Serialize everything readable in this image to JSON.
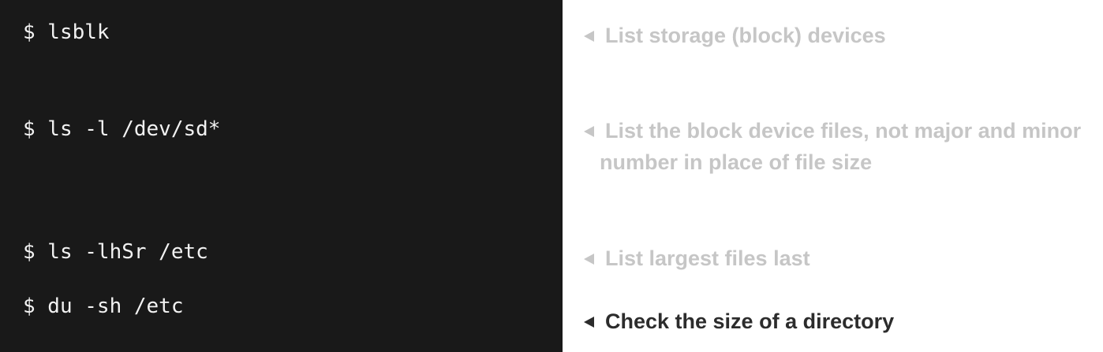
{
  "commands": [
    {
      "text": "$ lsblk"
    },
    {
      "text": "$ ls -l /dev/sd*"
    },
    {
      "text": "$ ls -lhSr /etc"
    },
    {
      "text": "$ du -sh /etc"
    }
  ],
  "notes": [
    {
      "line1": "List storage (block) devices",
      "line2": "",
      "active": false
    },
    {
      "line1": "List the block device files, not major and minor",
      "line2": "number in place of file size",
      "active": false
    },
    {
      "line1": "List largest files last",
      "line2": "",
      "active": false
    },
    {
      "line1": "Check the size of a directory",
      "line2": "",
      "active": true
    }
  ],
  "colors": {
    "terminal_bg": "#191919",
    "terminal_text": "#f2f2f2",
    "note_inactive": "#c6c6c6",
    "note_active": "#2c2c2c"
  },
  "icons": {
    "note_marker": "triangle-left-icon"
  }
}
